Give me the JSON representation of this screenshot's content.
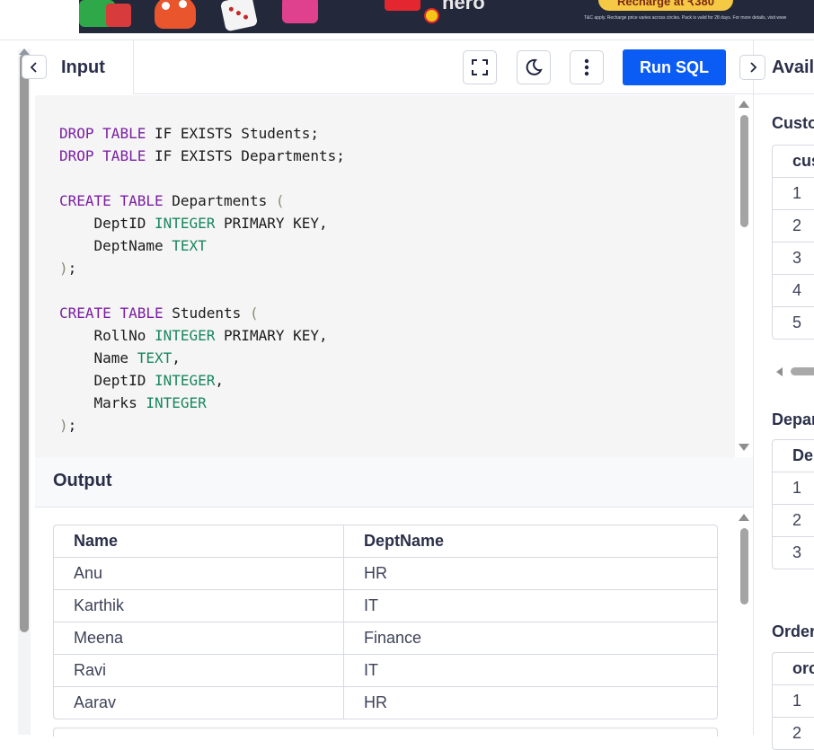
{
  "ad": {
    "brand": "hero",
    "cta": "Recharge at ₹380",
    "fine_print": "T&C apply. Recharge price varies across circles. Pack is valid for 28 days. For more details, visit www"
  },
  "input_panel": {
    "title": "Input",
    "collapse_icon": "chevron-left-icon",
    "fullscreen_icon": "fullscreen-icon",
    "theme_icon": "moon-icon",
    "menu_icon": "more-vertical-icon",
    "run_label": "Run SQL"
  },
  "code": {
    "lines": [
      [
        [
          "kw",
          "DROP"
        ],
        [
          "t",
          " "
        ],
        [
          "kw",
          "TABLE"
        ],
        [
          "t",
          " IF EXISTS Students;"
        ]
      ],
      [
        [
          "kw",
          "DROP"
        ],
        [
          "t",
          " "
        ],
        [
          "kw",
          "TABLE"
        ],
        [
          "t",
          " IF EXISTS Departments;"
        ]
      ],
      [],
      [
        [
          "kw",
          "CREATE"
        ],
        [
          "t",
          " "
        ],
        [
          "kw",
          "TABLE"
        ],
        [
          "t",
          " Departments "
        ],
        [
          "pu",
          "("
        ]
      ],
      [
        [
          "t",
          "    DeptID "
        ],
        [
          "ty",
          "INTEGER"
        ],
        [
          "t",
          " PRIMARY KEY,"
        ]
      ],
      [
        [
          "t",
          "    DeptName "
        ],
        [
          "ty",
          "TEXT"
        ]
      ],
      [
        [
          "pu",
          ")"
        ],
        [
          "t",
          ";"
        ]
      ],
      [],
      [
        [
          "kw",
          "CREATE"
        ],
        [
          "t",
          " "
        ],
        [
          "kw",
          "TABLE"
        ],
        [
          "t",
          " Students "
        ],
        [
          "pu",
          "("
        ]
      ],
      [
        [
          "t",
          "    RollNo "
        ],
        [
          "ty",
          "INTEGER"
        ],
        [
          "t",
          " PRIMARY KEY,"
        ]
      ],
      [
        [
          "t",
          "    Name "
        ],
        [
          "ty",
          "TEXT"
        ],
        [
          "t",
          ","
        ]
      ],
      [
        [
          "t",
          "    DeptID "
        ],
        [
          "ty",
          "INTEGER"
        ],
        [
          "t",
          ","
        ]
      ],
      [
        [
          "t",
          "    Marks "
        ],
        [
          "ty",
          "INTEGER"
        ]
      ],
      [
        [
          "pu",
          ")"
        ],
        [
          "t",
          ";"
        ]
      ]
    ]
  },
  "output": {
    "title": "Output",
    "columns": [
      "Name",
      "DeptName"
    ],
    "rows": [
      [
        "Anu",
        "HR"
      ],
      [
        "Karthik",
        "IT"
      ],
      [
        "Meena",
        "Finance"
      ],
      [
        "Ravi",
        "IT"
      ],
      [
        "Aarav",
        "HR"
      ]
    ]
  },
  "right_panel": {
    "title": "Avail",
    "expand_icon": "chevron-right-icon",
    "tables": [
      {
        "label": "Custo",
        "header": "cus",
        "rows": [
          "1",
          "2",
          "3",
          "4",
          "5"
        ]
      },
      {
        "label": "Depar",
        "header": "De",
        "rows": [
          "1",
          "2",
          "3"
        ]
      },
      {
        "label": "Order",
        "header": "orc",
        "rows": [
          "1",
          "2"
        ]
      }
    ]
  },
  "colors": {
    "accent": "#0a5cf5",
    "keyword": "#7b1fa2",
    "type": "#19875f",
    "text": "#2b3049"
  }
}
